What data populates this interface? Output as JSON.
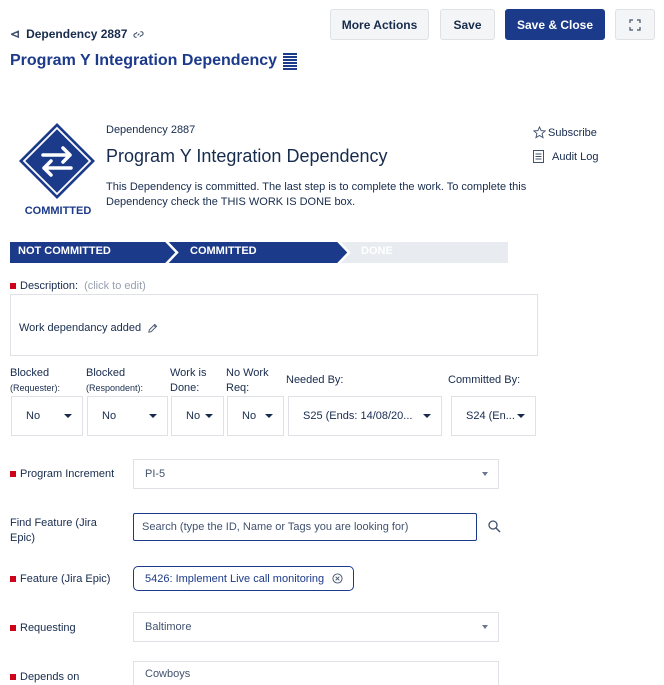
{
  "header": {
    "breadcrumb": "Dependency 2887",
    "actions": {
      "more": "More Actions",
      "save": "Save",
      "save_close": "Save & Close"
    },
    "title": "Program Y Integration Dependency"
  },
  "summary": {
    "status": "COMMITTED",
    "id": "Dependency 2887",
    "title": "Program Y Integration Dependency",
    "message": "This Dependency is committed. The last step is to complete the work. To complete this Dependency check the THIS WORK IS DONE box.",
    "subscribe": "Subscribe",
    "audit_log": "Audit Log"
  },
  "progress": {
    "steps": [
      "NOT COMMITTED",
      "COMMITTED",
      "DONE"
    ],
    "current_step": 2
  },
  "description": {
    "label": "Description:",
    "hint": "(click to edit)",
    "value": "Work dependancy added"
  },
  "fields": [
    {
      "label": "Blocked",
      "sub": "(Requester):",
      "value": "No"
    },
    {
      "label": "Blocked",
      "sub": "(Respondent):",
      "value": "No"
    },
    {
      "label": "Work is",
      "sub": "Done:",
      "value": "No"
    },
    {
      "label": "No Work",
      "sub": "Req:",
      "value": "No"
    },
    {
      "label": "Needed By:",
      "sub": "",
      "value": "S25 (Ends: 14/08/20..."
    },
    {
      "label": "Committed By:",
      "sub": "",
      "value": "S24 (En..."
    }
  ],
  "form": {
    "program_increment": {
      "label": "Program Increment",
      "value": "PI-5"
    },
    "find_feature": {
      "label": "Find Feature (Jira Epic)",
      "placeholder": "Search (type the ID, Name or Tags you are looking for)"
    },
    "feature": {
      "label": "Feature (Jira Epic)",
      "value": "5426: Implement Live call monitoring"
    },
    "requesting": {
      "label": "Requesting",
      "value": "Baltimore"
    },
    "depends_on": {
      "label": "Depends on",
      "value": "Cowboys"
    }
  },
  "colors": {
    "brand": "#1c3a8a",
    "required": "#d0021b",
    "step_inactive": "#e8ebf0"
  }
}
